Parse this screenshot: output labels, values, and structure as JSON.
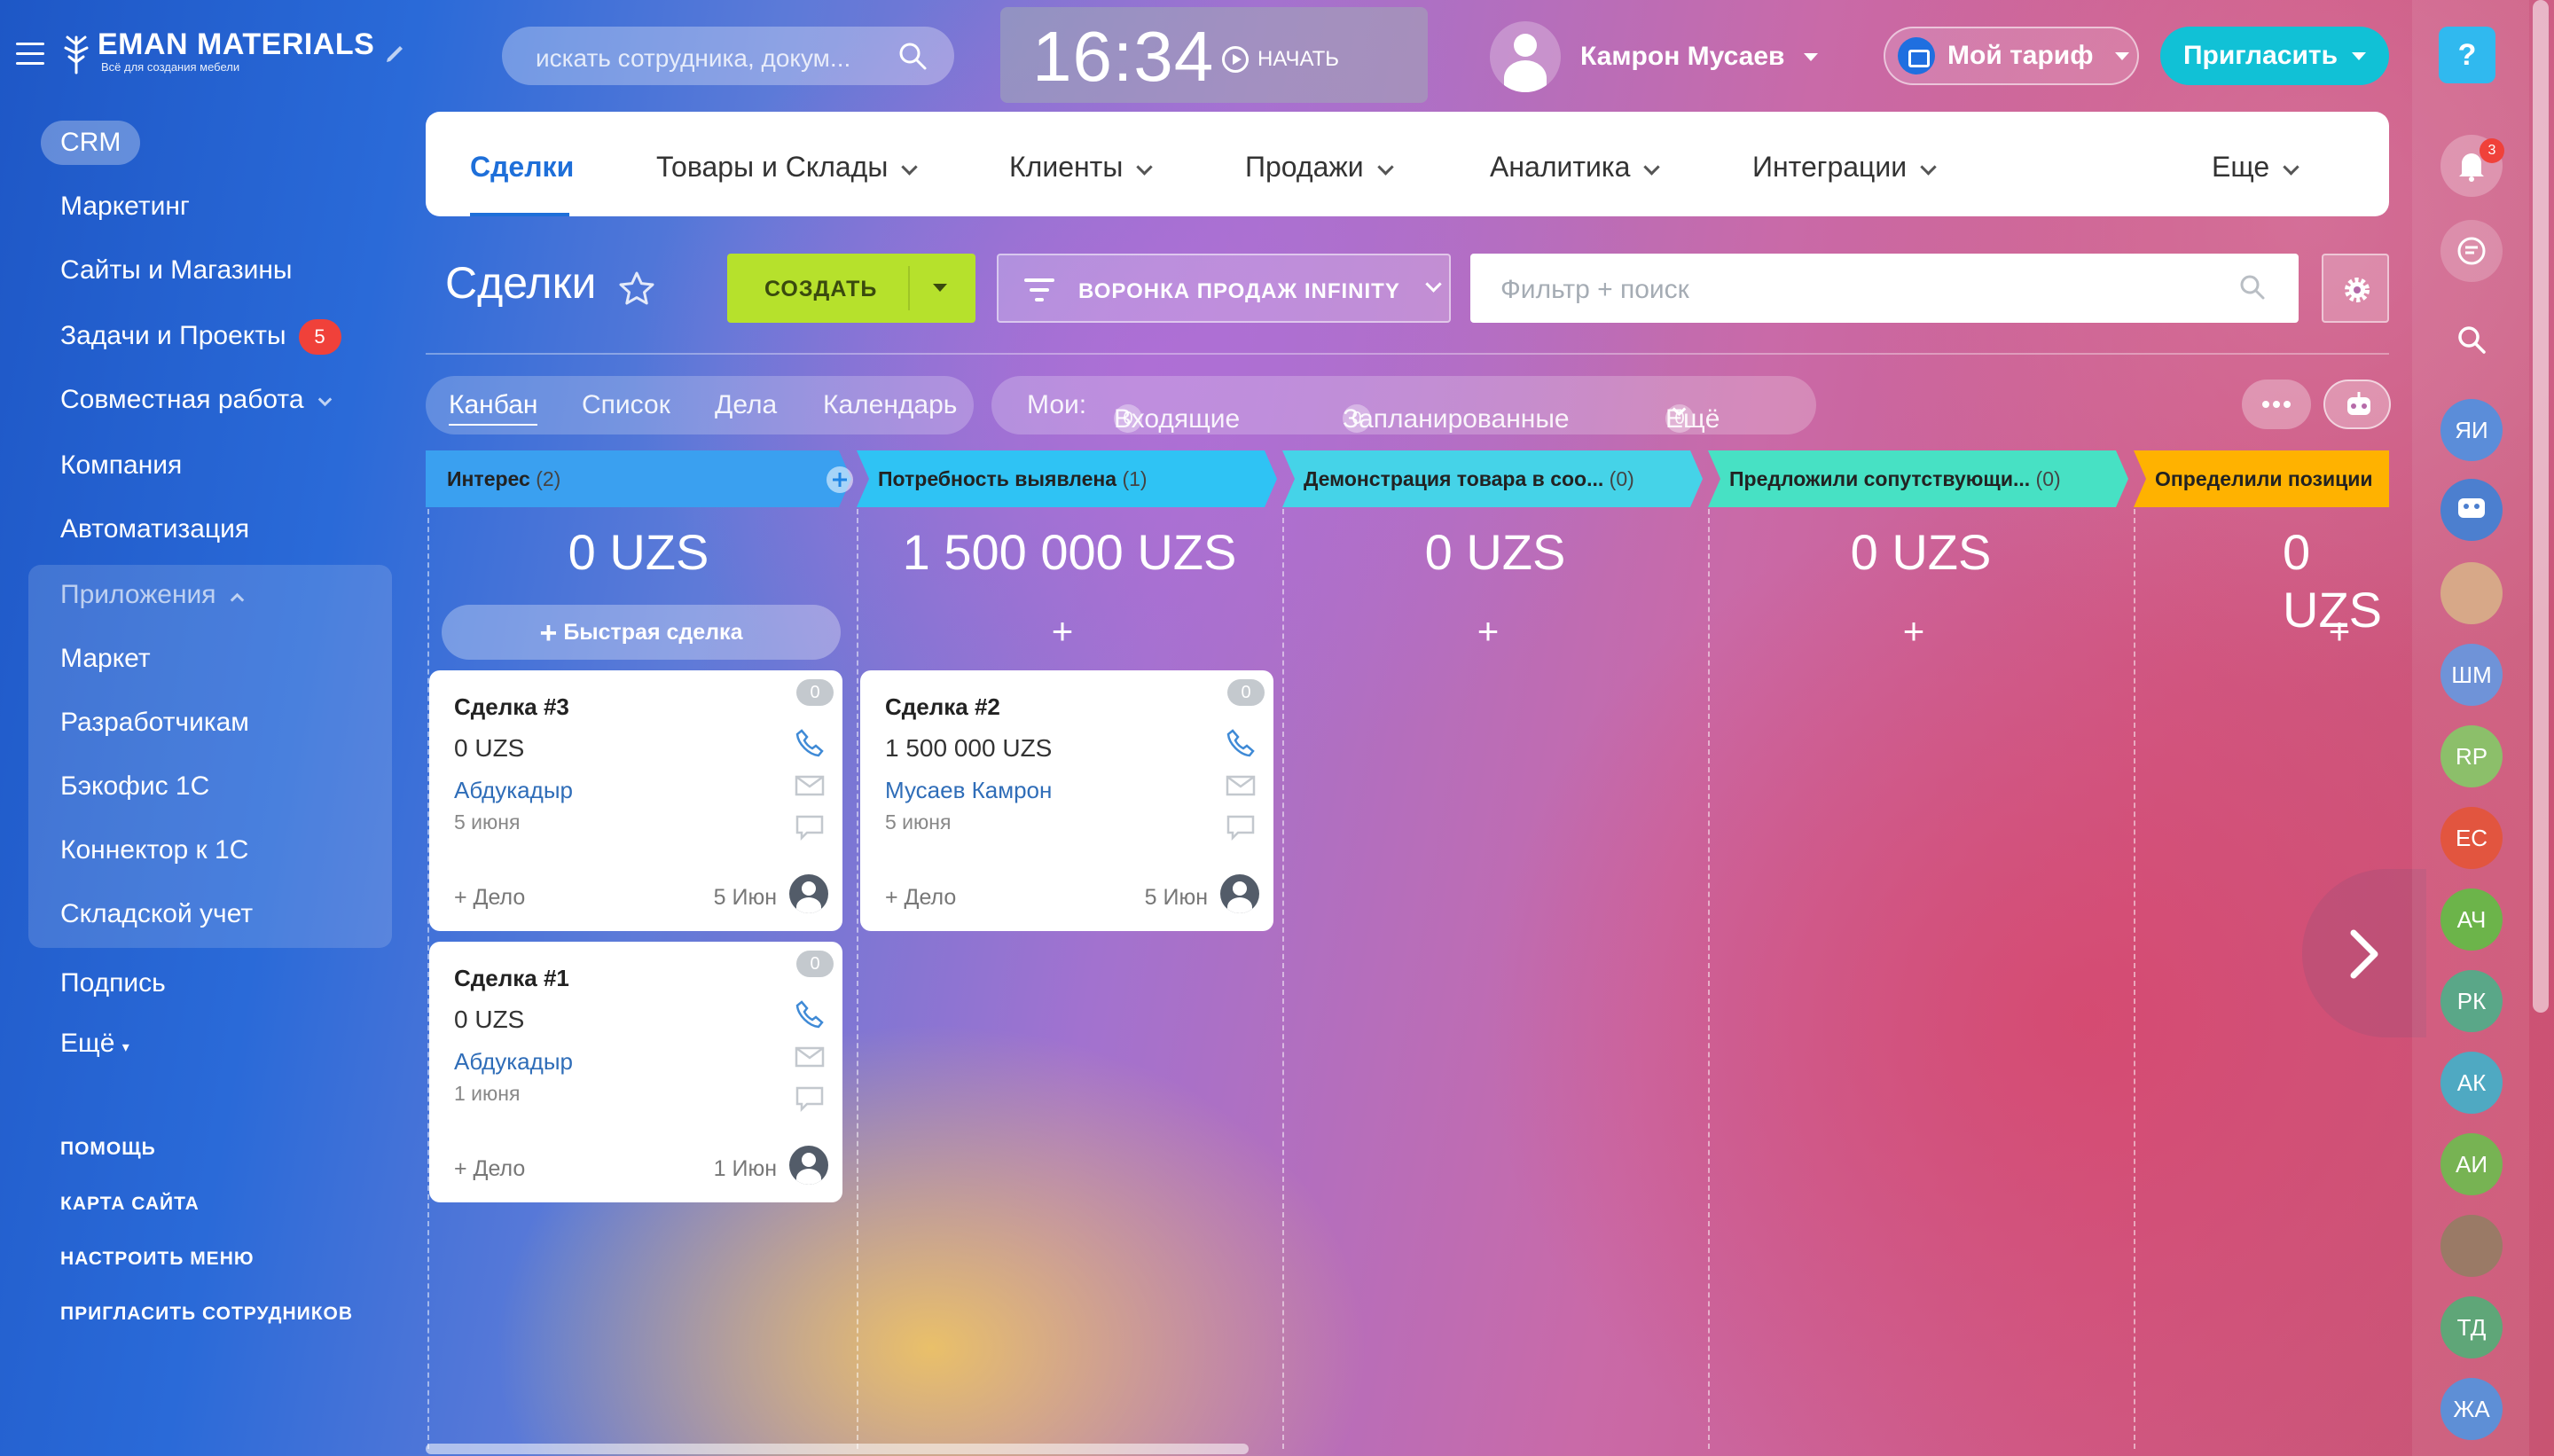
{
  "app": {
    "logo_title": "EMAN MATERIALS",
    "logo_subtitle": "Всё для создания мебели",
    "search_placeholder": "искать сотрудника, докум...",
    "clock_time": "16:34",
    "clock_start": "НАЧАТЬ",
    "user_name": "Камрон Мусаев",
    "tariff_label": "Мой тариф",
    "invite_label": "Пригласить",
    "help_label": "?"
  },
  "sidebar": {
    "crm": "CRM",
    "items": [
      {
        "label": "Маркетинг"
      },
      {
        "label": "Сайты и Магазины"
      },
      {
        "label": "Задачи и Проекты",
        "badge": "5"
      },
      {
        "label": "Совместная работа"
      },
      {
        "label": "Компания"
      },
      {
        "label": "Автоматизация"
      }
    ],
    "apps_header": "Приложения",
    "apps": [
      {
        "label": "Маркет"
      },
      {
        "label": "Разработчикам"
      },
      {
        "label": "Бэкофис 1С"
      },
      {
        "label": "Коннектор к 1С"
      },
      {
        "label": "Складской учет"
      }
    ],
    "after": [
      {
        "label": "Подпись"
      },
      {
        "label": "Ещё"
      }
    ],
    "footer": [
      {
        "label": "ПОМОЩЬ"
      },
      {
        "label": "КАРТА САЙТА"
      },
      {
        "label": "НАСТРОИТЬ МЕНЮ"
      },
      {
        "label": "ПРИГЛАСИТЬ СОТРУДНИКОВ"
      }
    ]
  },
  "topmenu": {
    "items": [
      {
        "label": "Сделки"
      },
      {
        "label": "Товары и Склады"
      },
      {
        "label": "Клиенты"
      },
      {
        "label": "Продажи"
      },
      {
        "label": "Аналитика"
      },
      {
        "label": "Интеграции"
      },
      {
        "label": "Еще"
      }
    ]
  },
  "toolbar": {
    "title": "Сделки",
    "create": "СОЗДАТЬ",
    "funnel": "ВОРОНКА ПРОДАЖ INFINITY",
    "filter_placeholder": "Фильтр + поиск"
  },
  "views": {
    "items": [
      "Канбан",
      "Список",
      "Дела",
      "Календарь"
    ],
    "mine": "Мои:",
    "incoming_count": "0",
    "incoming": "Входящие",
    "planned_count": "0",
    "planned": "Запланированные",
    "more": "Ещё",
    "more_count": "0"
  },
  "columns": [
    {
      "title": "Интерес",
      "count": "(2)",
      "sum": "0 UZS",
      "color": "#3aa0f0"
    },
    {
      "title": "Потребность выявлена",
      "count": "(1)",
      "sum": "1 500 000 UZS",
      "color": "#2fc3f4"
    },
    {
      "title": "Демонстрация товара в соо...",
      "count": "(0)",
      "sum": "0 UZS",
      "color": "#45d3e8"
    },
    {
      "title": "Предложили сопутствующи...",
      "count": "(0)",
      "sum": "0 UZS",
      "color": "#47e1c4"
    },
    {
      "title": "Определили позиции",
      "count": "",
      "sum": "0 UZS",
      "color": "#ffb200"
    }
  ],
  "quick_deal": "Быстрая сделка",
  "cards": [
    {
      "title": "Сделка #3",
      "amount": "0 UZS",
      "client": "Абдукадыр",
      "date": "5 июня",
      "add": "+ Дело",
      "deadline": "5 Июн",
      "activities": "0"
    },
    {
      "title": "Сделка #2",
      "amount": "1 500 000 UZS",
      "client": "Мусаев Камрон",
      "date": "5 июня",
      "add": "+ Дело",
      "deadline": "5 Июн",
      "activities": "0"
    },
    {
      "title": "Сделка #1",
      "amount": "0 UZS",
      "client": "Абдукадыр",
      "date": "1 июня",
      "add": "+ Дело",
      "deadline": "1 Июн",
      "activities": "0"
    }
  ],
  "rail": {
    "notifications": "3",
    "avatars": [
      {
        "initials": "ЯИ",
        "color": "#5b8dd9"
      },
      {
        "initials": "ШМ",
        "color": "#6f93d8"
      },
      {
        "initials": "RP",
        "color": "#8cbf6a"
      },
      {
        "initials": "EC",
        "color": "#e2553f"
      },
      {
        "initials": "АЧ",
        "color": "#6cb44a"
      },
      {
        "initials": "РК",
        "color": "#5aa788"
      },
      {
        "initials": "АК",
        "color": "#4fa9c2"
      },
      {
        "initials": "АИ",
        "color": "#77b353"
      },
      {
        "initials": "ТД",
        "color": "#5fa678"
      },
      {
        "initials": "ЖА",
        "color": "#5e8fd6"
      }
    ]
  }
}
